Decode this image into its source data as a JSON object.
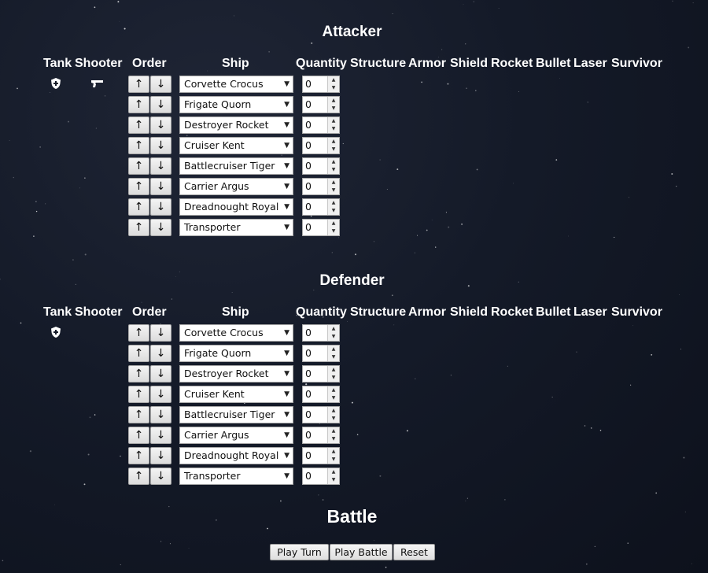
{
  "attacker": {
    "title": "Attacker",
    "columns": [
      "Tank",
      "Shooter",
      "Order",
      "Ship",
      "Quantity",
      "Structure",
      "Armor",
      "Shield",
      "Rocket",
      "Bullet",
      "Laser",
      "Survivor"
    ],
    "tank_icon": "shield-icon",
    "shooter_icon": "pistol-icon",
    "ships": [
      {
        "name": "Corvette Crocus",
        "quantity": "0"
      },
      {
        "name": "Frigate Quorn",
        "quantity": "0"
      },
      {
        "name": "Destroyer Rocket",
        "quantity": "0"
      },
      {
        "name": "Cruiser Kent",
        "quantity": "0"
      },
      {
        "name": "Battlecruiser Tiger",
        "quantity": "0"
      },
      {
        "name": "Carrier Argus",
        "quantity": "0"
      },
      {
        "name": "Dreadnought Royal",
        "quantity": "0"
      },
      {
        "name": "Transporter",
        "quantity": "0"
      }
    ]
  },
  "defender": {
    "title": "Defender",
    "columns": [
      "Tank",
      "Shooter",
      "Order",
      "Ship",
      "Quantity",
      "Structure",
      "Armor",
      "Shield",
      "Rocket",
      "Bullet",
      "Laser",
      "Survivor"
    ],
    "tank_icon": "shield-icon",
    "ships": [
      {
        "name": "Corvette Crocus",
        "quantity": "0"
      },
      {
        "name": "Frigate Quorn",
        "quantity": "0"
      },
      {
        "name": "Destroyer Rocket",
        "quantity": "0"
      },
      {
        "name": "Cruiser Kent",
        "quantity": "0"
      },
      {
        "name": "Battlecruiser Tiger",
        "quantity": "0"
      },
      {
        "name": "Carrier Argus",
        "quantity": "0"
      },
      {
        "name": "Dreadnought Royal",
        "quantity": "0"
      },
      {
        "name": "Transporter",
        "quantity": "0"
      }
    ]
  },
  "order_buttons": {
    "up": "↑",
    "down": "↓"
  },
  "battle": {
    "title": "Battle",
    "play_turn": "Play Turn",
    "play_battle": "Play Battle",
    "reset": "Reset"
  }
}
